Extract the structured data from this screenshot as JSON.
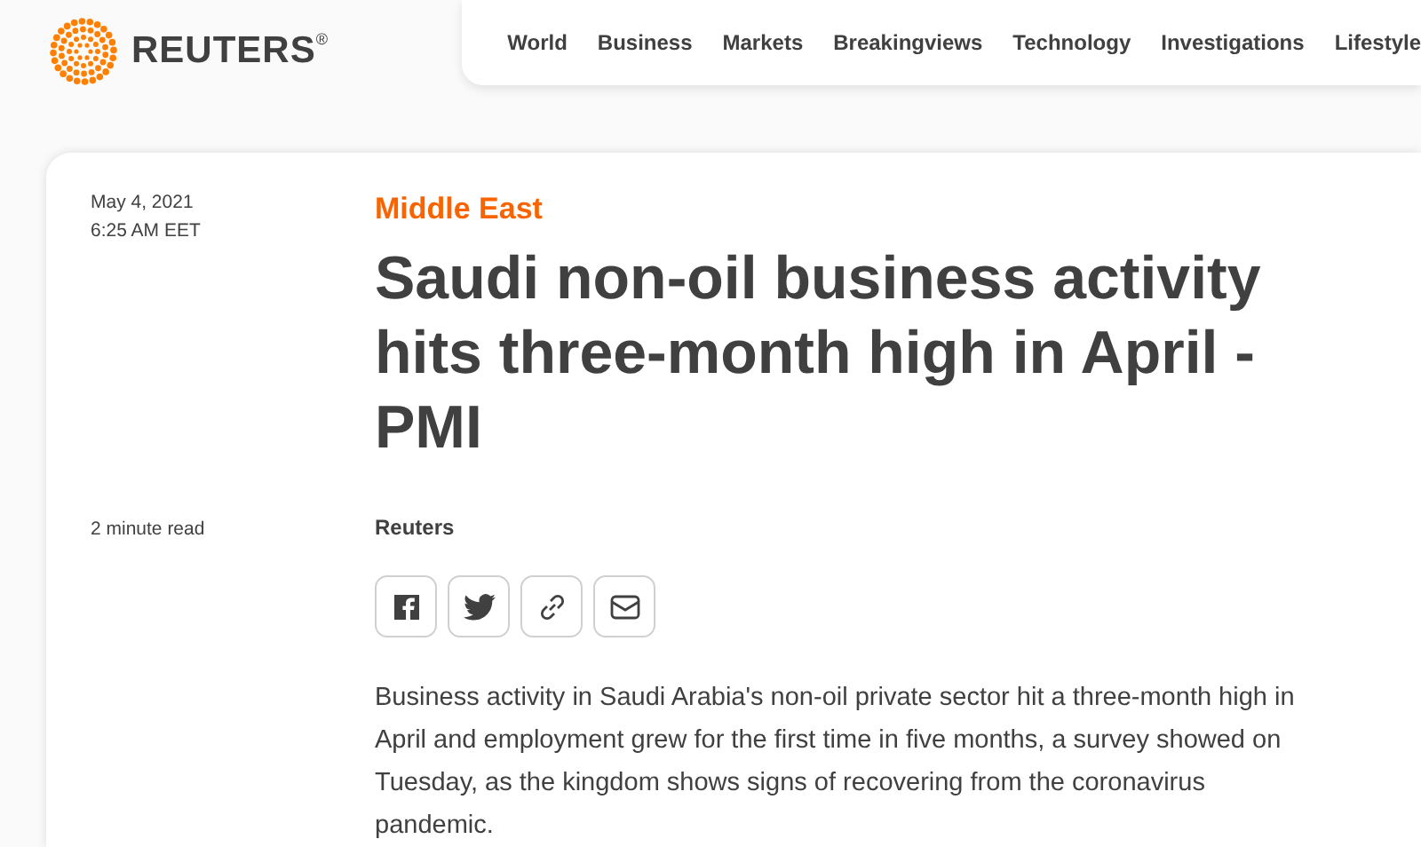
{
  "logo": {
    "text": "REUTERS$^{®}$"
  },
  "nav": [
    {
      "label": "World"
    },
    {
      "label": "Business"
    },
    {
      "label": "Markets"
    },
    {
      "label": "Breakingviews"
    },
    {
      "label": "Technology"
    },
    {
      "label": "Investigations"
    },
    {
      "label": "Lifestyle"
    }
  ],
  "article": {
    "date": "May 4, 2021",
    "time": "6:25 AM EET",
    "section": "Middle East",
    "headline": "Saudi non-oil business activity hits three-month high in April - PMI",
    "read_time": "2 minute read",
    "byline": "Reuters",
    "share": [
      {
        "kind": "facebook"
      },
      {
        "kind": "twitter"
      },
      {
        "kind": "link"
      },
      {
        "kind": "email"
      }
    ],
    "body": "Business activity in Saudi Arabia's non-oil private sector hit a three-month high in April and employment grew for the first time in five months, a survey showed on Tuesday, as the kingdom shows signs of recovering from the coronavirus pandemic."
  }
}
